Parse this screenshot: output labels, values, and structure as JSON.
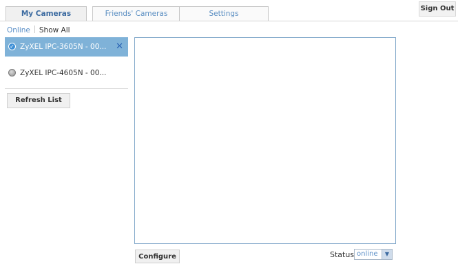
{
  "tabs": [
    {
      "label": "My Cameras",
      "active": true
    },
    {
      "label": "Friends' Cameras",
      "active": false
    },
    {
      "label": "Settings",
      "active": false
    }
  ],
  "header": {
    "sign_out_label": "Sign Out"
  },
  "filter": {
    "online_label": "Online",
    "show_all_label": "Show All"
  },
  "cameras": [
    {
      "name": "ZyXEL IPC-3605N - 00...",
      "status": "online",
      "selected": true,
      "close_glyph": "✕"
    },
    {
      "name": "ZyXEL IPC-4605N - 00...",
      "status": "offline",
      "selected": false
    }
  ],
  "sidebar": {
    "refresh_label": "Refresh List"
  },
  "footer": {
    "configure_label": "Configure",
    "status_label": "Status",
    "status_value": "online"
  },
  "colors": {
    "accent": "#5b8fc7",
    "selected_row": "#7fb2d8",
    "viewer_border": "#7fa6c9"
  },
  "icons": {
    "online": "check-circle-icon",
    "offline": "gray-dot-icon",
    "close": "close-icon",
    "dropdown": "chevron-down-icon"
  }
}
